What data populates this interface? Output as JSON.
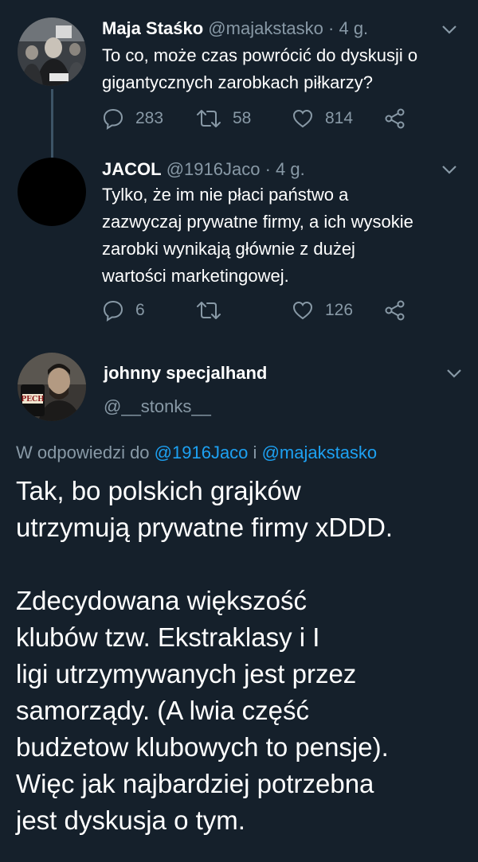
{
  "tweet1": {
    "name": "Maja Staśko",
    "handle": "@majakstasko",
    "time": "· 4 g.",
    "text_lines": [
      "To co, może czas powrócić do dyskusji o",
      "gigantycznych zarobkach piłkarzy?"
    ],
    "replies": "283",
    "retweets": "58",
    "likes": "814"
  },
  "tweet2": {
    "name": "JACOL",
    "handle": "@1916Jaco",
    "time": "· 4 g.",
    "text_lines": [
      "Tylko, że im nie płaci państwo a",
      "zazwyczaj prywatne firmy, a ich wysokie",
      "zarobki wynikają głównie z dużej",
      "wartości marketingowej."
    ],
    "replies": "6",
    "retweets": "",
    "likes": "126"
  },
  "tweet3": {
    "name": "johnny specjalhand",
    "handle": "@__stonks__",
    "avatar_text": "PECH",
    "reply_prefix": "W odpowiedzi do",
    "reply_mention1": "@1916Jaco",
    "reply_and": "i",
    "reply_mention2": "@majakstasko",
    "para1": [
      "Tak, bo polskich grajków",
      "utrzymują prywatne firmy xDDD."
    ],
    "para2": [
      "Zdecydowana większość",
      "klubów tzw. Ekstraklasy i I",
      "ligi utrzymywanych jest przez",
      "samorządy. (A lwia część",
      "budżetow klubowych to pensje).",
      "Więc jak najbardziej potrzebna",
      "jest dyskusja o tym."
    ]
  },
  "colors": {
    "background": "#15202b",
    "secondary_text": "#8899a6",
    "link": "#1da1f2",
    "thread_line": "#3d5466"
  }
}
